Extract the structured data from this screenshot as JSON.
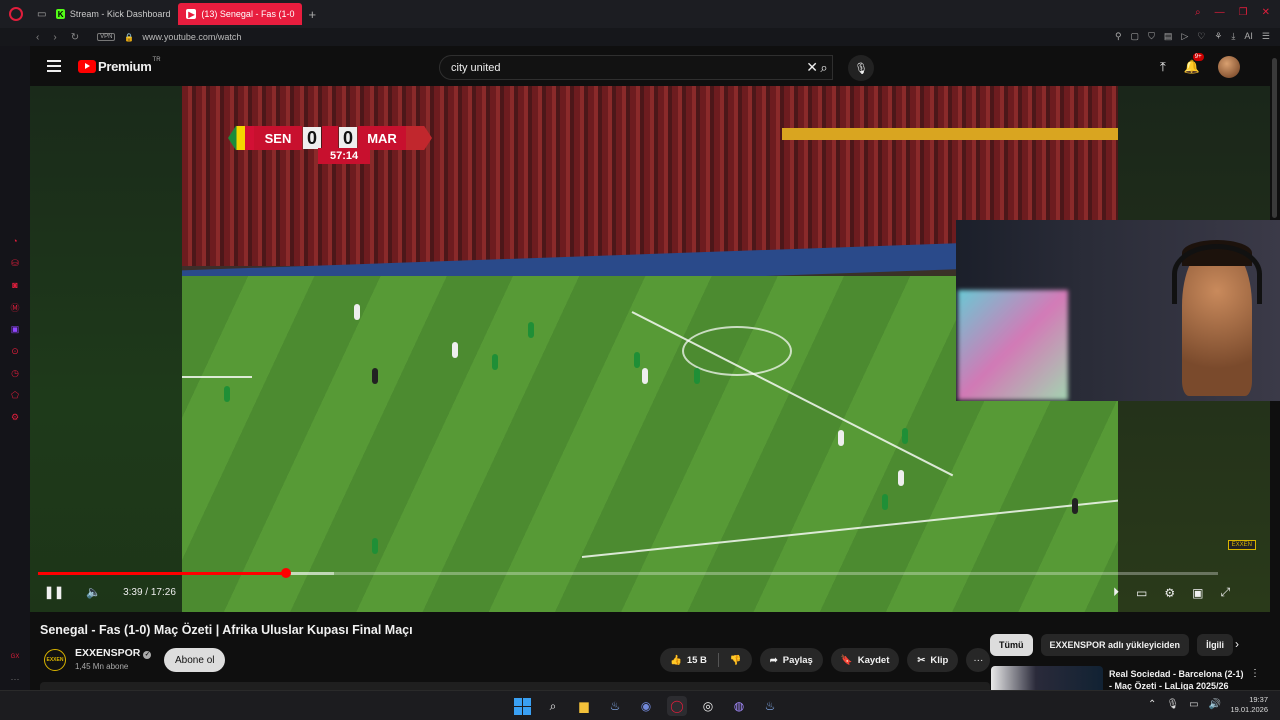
{
  "browser": {
    "tabs": [
      {
        "label": "Stream - Kick Dashboard",
        "icon": "kick-icon"
      },
      {
        "label": "(13) Senegal - Fas (1-0",
        "icon": "youtube-icon",
        "active": true
      }
    ],
    "url": "www.youtube.com/watch",
    "vpn_label": "VPN"
  },
  "youtube": {
    "brand": "Premium",
    "country": "TR",
    "search_query": "city united",
    "notif_count": "9+"
  },
  "scoreboard": {
    "home": "SEN",
    "away": "MAR",
    "home_score": "0",
    "away_score": "0",
    "clock": "57:14"
  },
  "watermark": "EXXEN",
  "player": {
    "current_time": "3:39",
    "duration": "17:26",
    "time_display": "3:39 / 17:26",
    "progress_fraction": 0.21
  },
  "video": {
    "title": "Senegal - Fas (1-0) Maç Özeti | Afrika Uluslar Kupası Final Maçı",
    "channel": "EXXENSPOR",
    "channel_avatar_text": "EXXEN",
    "subscribers": "1,45 Mn abone",
    "subscribe_label": "Abone ol",
    "likes": "15 B",
    "share_label": "Paylaş",
    "save_label": "Kaydet",
    "clip_label": "Klip"
  },
  "related": {
    "chips": [
      "Tümü",
      "EXXENSPOR adlı yükleyiciden",
      "İlgili"
    ],
    "first_title": "Real Sociedad - Barcelona (2-1) - Maç Özeti - LaLiga 2025/26"
  },
  "taskbar": {
    "time": "19:37",
    "date": "19.01.2026"
  },
  "colors": {
    "accent_red": "#e81d3e",
    "youtube_red": "#ff0000",
    "pitch_green": "#4c8b30"
  }
}
